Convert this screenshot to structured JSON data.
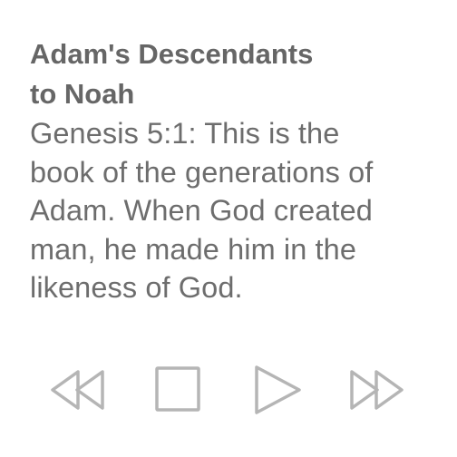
{
  "passage": {
    "title_line1": "Adam's Descendants",
    "title_line2": "to Noah",
    "verse_lines": [
      "Genesis 5:1: This is the",
      "book of the generations of",
      "Adam. When God created",
      "man, he made him in the",
      "likeness of God."
    ]
  },
  "controls": {
    "rewind_icon": "rewind-icon",
    "stop_icon": "stop-icon",
    "play_icon": "play-icon",
    "forward_icon": "fast-forward-icon"
  },
  "colors": {
    "title": "#666666",
    "text": "#6d6d6d",
    "icon_stroke": "#b5b5b5",
    "background": "#ffffff"
  }
}
